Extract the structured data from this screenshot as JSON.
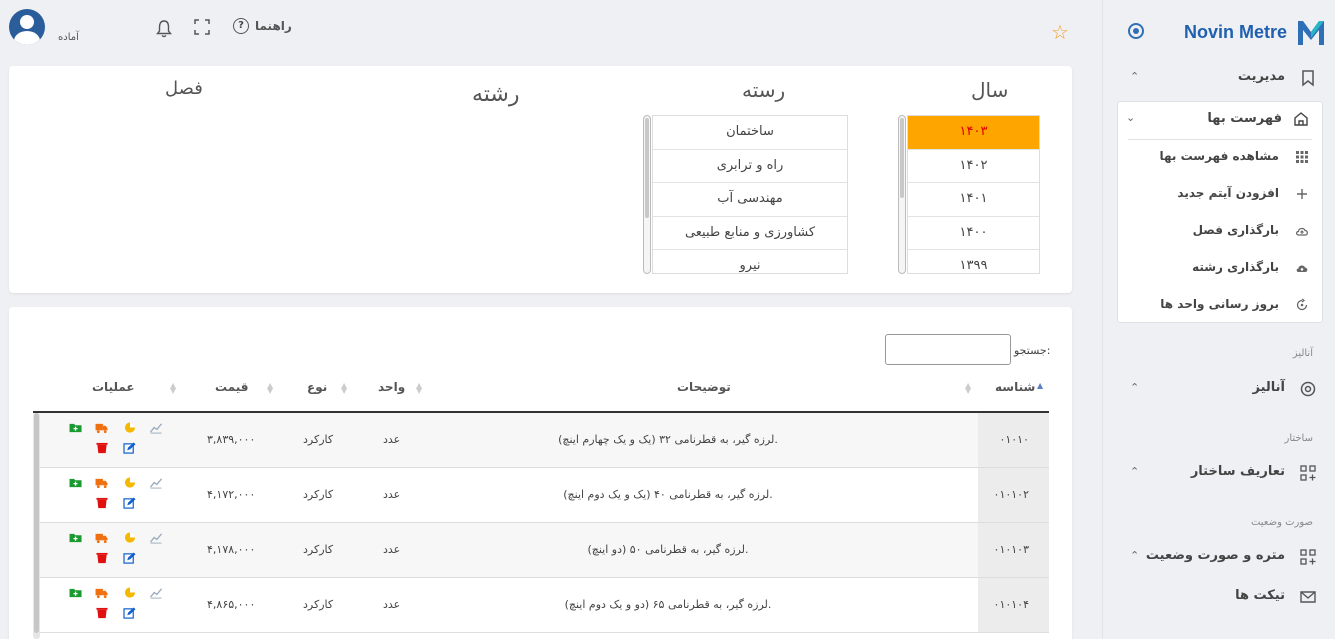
{
  "brand": {
    "name": "Novin Metre"
  },
  "topbar": {
    "status": "آماده",
    "help_label": "راهنما"
  },
  "sidebar": {
    "management": {
      "label": "مدیریت"
    },
    "price_list": {
      "label": "فهرست بها"
    },
    "sub_items": [
      {
        "label": "مشاهده فهرست بها",
        "icon": "grid-icon"
      },
      {
        "label": "افزودن آیتم جدید",
        "icon": "plus-icon"
      },
      {
        "label": "بارگذاری فصل",
        "icon": "cloud-upload-icon"
      },
      {
        "label": "بارگذاری رشته",
        "icon": "cloud-upload-filled-icon"
      },
      {
        "label": "بروز رسانی واحد ها",
        "icon": "refresh-icon"
      }
    ],
    "section_analysis": "آنالیز",
    "analysis": {
      "label": "آنالیز"
    },
    "section_structure": "ساختار",
    "structure": {
      "label": "تعاریف ساختار"
    },
    "section_status": "صورت وضعیت",
    "metre": {
      "label": "متره و صورت وضعیت"
    },
    "tickets": {
      "label": "تیکت ها"
    }
  },
  "selector": {
    "year_title": "سال",
    "category_title": "رسته",
    "field_title": "رشته",
    "chapter_title": "فصل",
    "years": [
      "۱۴۰۳",
      "۱۴۰۲",
      "۱۴۰۱",
      "۱۴۰۰",
      "۱۳۹۹"
    ],
    "categories": [
      "ساختمان",
      "راه و ترابری",
      "مهندسی آب",
      "کشاورزی و منابع طبیعی",
      "نیرو"
    ]
  },
  "table": {
    "search_label": "جستجو:",
    "search_value": "",
    "headers": {
      "id": "شناسه",
      "desc": "توضیحات",
      "unit": "واحد",
      "type": "نوع",
      "price": "قیمت",
      "ops": "عملیات"
    },
    "rows": [
      {
        "id": "۰۱۰۱۰",
        "desc": "لرزه گیر، به قطرنامی ۳۲ (یک و یک چهارم اینچ).",
        "unit": "عدد",
        "type": "کارکرد",
        "price": "۳,۸۳۹,۰۰۰"
      },
      {
        "id": "۰۱۰۱۰۲",
        "desc": "لرزه گیر، به قطرنامی ۴۰ (یک و یک دوم اینچ).",
        "unit": "عدد",
        "type": "کارکرد",
        "price": "۴,۱۷۲,۰۰۰"
      },
      {
        "id": "۰۱۰۱۰۳",
        "desc": "لرزه گیر، به قطرنامی ۵۰ (دو اینچ).",
        "unit": "عدد",
        "type": "کارکرد",
        "price": "۴,۱۷۸,۰۰۰"
      },
      {
        "id": "۰۱۰۱۰۴",
        "desc": "لرزه گیر، به قطرنامی ۶۵ (دو و یک دوم اینچ).",
        "unit": "عدد",
        "type": "کارکرد",
        "price": "۴,۸۶۵,۰۰۰"
      }
    ]
  },
  "colors": {
    "accent": "#2060b0",
    "selected": "#ffa500",
    "star": "#f0a030"
  }
}
